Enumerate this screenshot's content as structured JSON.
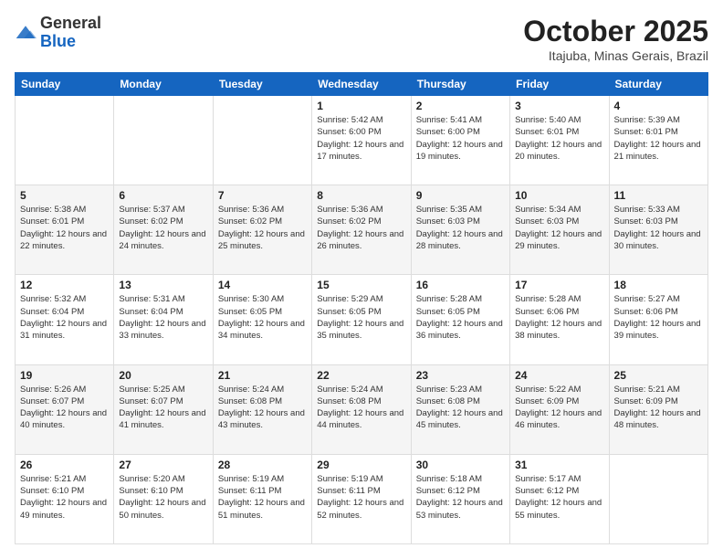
{
  "logo": {
    "general": "General",
    "blue": "Blue"
  },
  "header": {
    "month": "October 2025",
    "location": "Itajuba, Minas Gerais, Brazil"
  },
  "weekdays": [
    "Sunday",
    "Monday",
    "Tuesday",
    "Wednesday",
    "Thursday",
    "Friday",
    "Saturday"
  ],
  "weeks": [
    [
      {
        "day": "",
        "info": ""
      },
      {
        "day": "",
        "info": ""
      },
      {
        "day": "",
        "info": ""
      },
      {
        "day": "1",
        "info": "Sunrise: 5:42 AM\nSunset: 6:00 PM\nDaylight: 12 hours and 17 minutes."
      },
      {
        "day": "2",
        "info": "Sunrise: 5:41 AM\nSunset: 6:00 PM\nDaylight: 12 hours and 19 minutes."
      },
      {
        "day": "3",
        "info": "Sunrise: 5:40 AM\nSunset: 6:01 PM\nDaylight: 12 hours and 20 minutes."
      },
      {
        "day": "4",
        "info": "Sunrise: 5:39 AM\nSunset: 6:01 PM\nDaylight: 12 hours and 21 minutes."
      }
    ],
    [
      {
        "day": "5",
        "info": "Sunrise: 5:38 AM\nSunset: 6:01 PM\nDaylight: 12 hours and 22 minutes."
      },
      {
        "day": "6",
        "info": "Sunrise: 5:37 AM\nSunset: 6:02 PM\nDaylight: 12 hours and 24 minutes."
      },
      {
        "day": "7",
        "info": "Sunrise: 5:36 AM\nSunset: 6:02 PM\nDaylight: 12 hours and 25 minutes."
      },
      {
        "day": "8",
        "info": "Sunrise: 5:36 AM\nSunset: 6:02 PM\nDaylight: 12 hours and 26 minutes."
      },
      {
        "day": "9",
        "info": "Sunrise: 5:35 AM\nSunset: 6:03 PM\nDaylight: 12 hours and 28 minutes."
      },
      {
        "day": "10",
        "info": "Sunrise: 5:34 AM\nSunset: 6:03 PM\nDaylight: 12 hours and 29 minutes."
      },
      {
        "day": "11",
        "info": "Sunrise: 5:33 AM\nSunset: 6:03 PM\nDaylight: 12 hours and 30 minutes."
      }
    ],
    [
      {
        "day": "12",
        "info": "Sunrise: 5:32 AM\nSunset: 6:04 PM\nDaylight: 12 hours and 31 minutes."
      },
      {
        "day": "13",
        "info": "Sunrise: 5:31 AM\nSunset: 6:04 PM\nDaylight: 12 hours and 33 minutes."
      },
      {
        "day": "14",
        "info": "Sunrise: 5:30 AM\nSunset: 6:05 PM\nDaylight: 12 hours and 34 minutes."
      },
      {
        "day": "15",
        "info": "Sunrise: 5:29 AM\nSunset: 6:05 PM\nDaylight: 12 hours and 35 minutes."
      },
      {
        "day": "16",
        "info": "Sunrise: 5:28 AM\nSunset: 6:05 PM\nDaylight: 12 hours and 36 minutes."
      },
      {
        "day": "17",
        "info": "Sunrise: 5:28 AM\nSunset: 6:06 PM\nDaylight: 12 hours and 38 minutes."
      },
      {
        "day": "18",
        "info": "Sunrise: 5:27 AM\nSunset: 6:06 PM\nDaylight: 12 hours and 39 minutes."
      }
    ],
    [
      {
        "day": "19",
        "info": "Sunrise: 5:26 AM\nSunset: 6:07 PM\nDaylight: 12 hours and 40 minutes."
      },
      {
        "day": "20",
        "info": "Sunrise: 5:25 AM\nSunset: 6:07 PM\nDaylight: 12 hours and 41 minutes."
      },
      {
        "day": "21",
        "info": "Sunrise: 5:24 AM\nSunset: 6:08 PM\nDaylight: 12 hours and 43 minutes."
      },
      {
        "day": "22",
        "info": "Sunrise: 5:24 AM\nSunset: 6:08 PM\nDaylight: 12 hours and 44 minutes."
      },
      {
        "day": "23",
        "info": "Sunrise: 5:23 AM\nSunset: 6:08 PM\nDaylight: 12 hours and 45 minutes."
      },
      {
        "day": "24",
        "info": "Sunrise: 5:22 AM\nSunset: 6:09 PM\nDaylight: 12 hours and 46 minutes."
      },
      {
        "day": "25",
        "info": "Sunrise: 5:21 AM\nSunset: 6:09 PM\nDaylight: 12 hours and 48 minutes."
      }
    ],
    [
      {
        "day": "26",
        "info": "Sunrise: 5:21 AM\nSunset: 6:10 PM\nDaylight: 12 hours and 49 minutes."
      },
      {
        "day": "27",
        "info": "Sunrise: 5:20 AM\nSunset: 6:10 PM\nDaylight: 12 hours and 50 minutes."
      },
      {
        "day": "28",
        "info": "Sunrise: 5:19 AM\nSunset: 6:11 PM\nDaylight: 12 hours and 51 minutes."
      },
      {
        "day": "29",
        "info": "Sunrise: 5:19 AM\nSunset: 6:11 PM\nDaylight: 12 hours and 52 minutes."
      },
      {
        "day": "30",
        "info": "Sunrise: 5:18 AM\nSunset: 6:12 PM\nDaylight: 12 hours and 53 minutes."
      },
      {
        "day": "31",
        "info": "Sunrise: 5:17 AM\nSunset: 6:12 PM\nDaylight: 12 hours and 55 minutes."
      },
      {
        "day": "",
        "info": ""
      }
    ]
  ]
}
